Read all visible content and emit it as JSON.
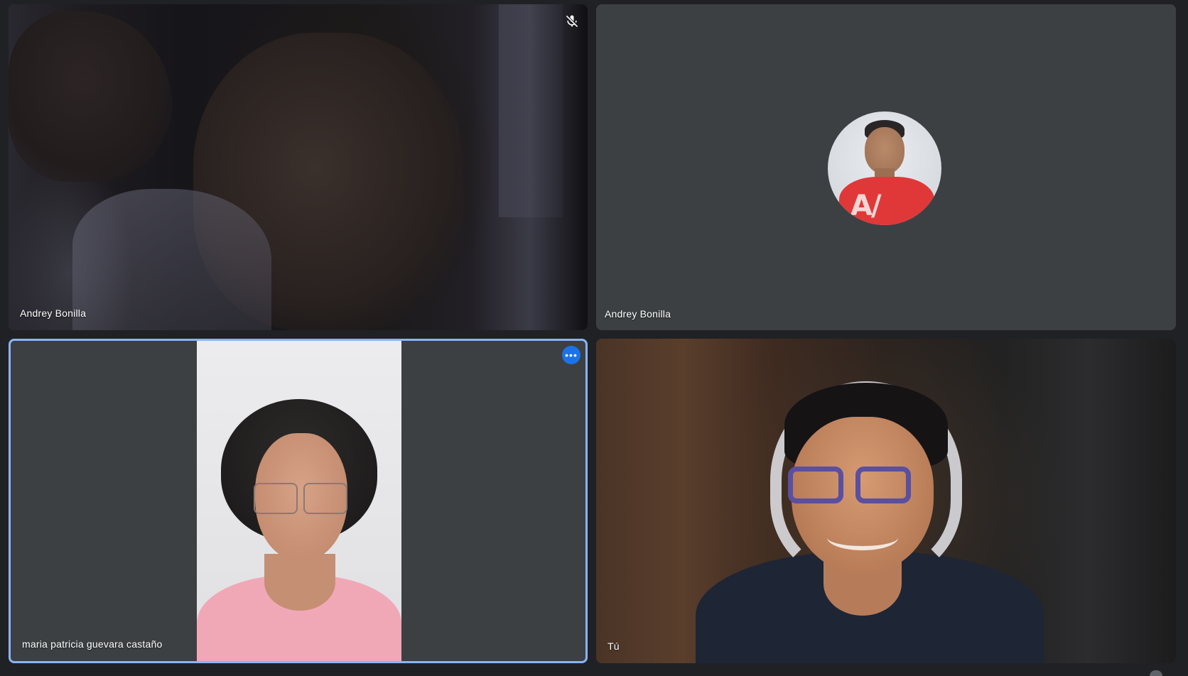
{
  "participants": [
    {
      "name": "Andrey Bonilla",
      "mic_muted": true,
      "video": "on"
    },
    {
      "name": "Andrey Bonilla",
      "mic_muted": false,
      "video": "avatar"
    },
    {
      "name": "maria patricia guevara castaño",
      "mic_muted": false,
      "video": "on",
      "active_speaker": true,
      "more_options_icon": "more-horizontal-icon"
    },
    {
      "name": "Tú",
      "mic_muted": false,
      "video": "on"
    }
  ],
  "colors": {
    "background": "#202124",
    "tile": "#3c4043",
    "active_border": "#8ab4f8",
    "accent": "#1a73e8"
  }
}
